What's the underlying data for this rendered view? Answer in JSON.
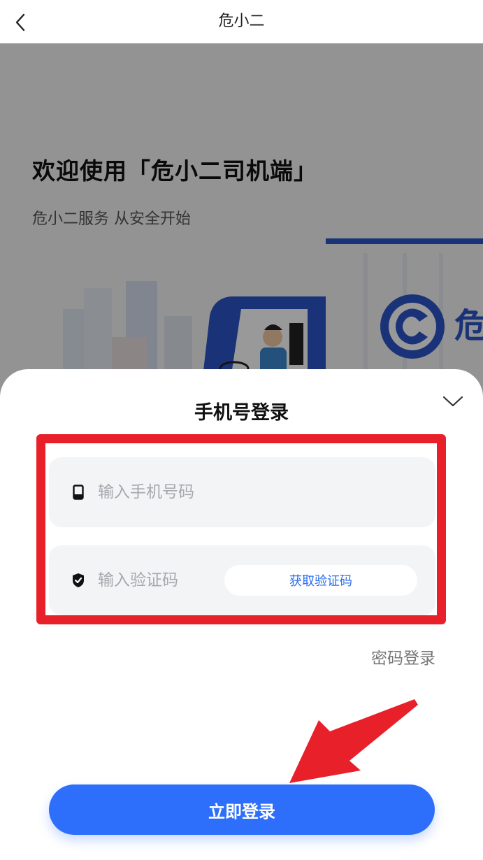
{
  "navbar": {
    "title": "危小二",
    "back_icon": "chevron-left-icon"
  },
  "background": {
    "welcome_title": "欢迎使用「危小二司机端」",
    "welcome_subtitle": "危小二服务 从安全开始",
    "brand_color": "#2c56c9"
  },
  "sheet": {
    "title": "手机号登录",
    "collapse_icon": "chevron-down-icon",
    "phone": {
      "placeholder": "输入手机号码",
      "value": "",
      "icon": "phone-icon"
    },
    "code": {
      "placeholder": "输入验证码",
      "value": "",
      "icon": "shield-icon",
      "get_code_label": "获取验证码"
    },
    "password_login_label": "密码登录",
    "submit_label": "立即登录"
  },
  "colors": {
    "accent": "#2d6efb",
    "link": "#2c6ef2",
    "annotation": "#e8202a",
    "field_bg": "#f3f4f6",
    "dim_overlay": "rgba(0,0,0,0.40)"
  }
}
